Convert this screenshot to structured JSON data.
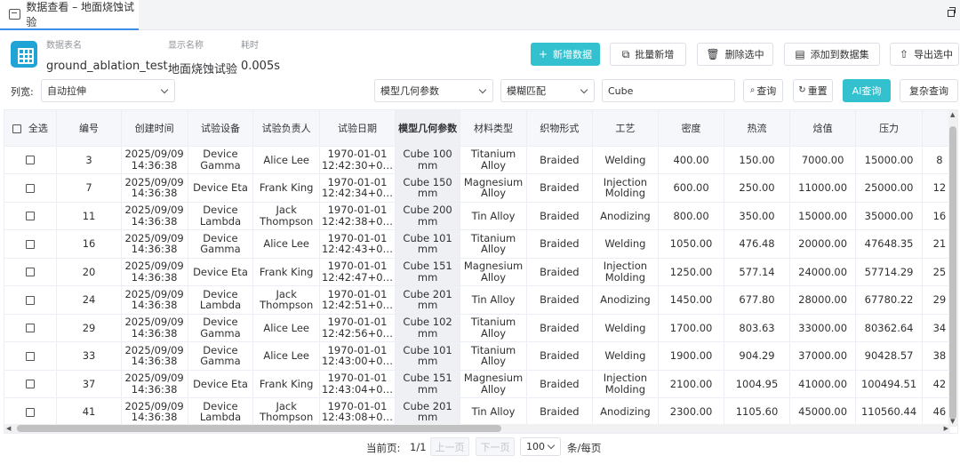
{
  "tab": {
    "title": "数据查看 – 地面烧蚀试验"
  },
  "info": {
    "table_name_label": "数据表名",
    "table_name": "ground_ablation_test",
    "display_name_label": "显示名称",
    "display_name": "地面烧蚀试验",
    "time_label": "耗时",
    "time": "0.005s"
  },
  "toolbar": {
    "add": "新增数据",
    "batch_add": "批量新增",
    "delete_selected": "删除选中",
    "add_to_dataset": "添加到数据集",
    "export_selected": "导出选中"
  },
  "filter": {
    "col_width_label": "列宽:",
    "col_width_value": "自动拉伸",
    "field_value": "模型几何参数",
    "match_value": "模糊匹配",
    "search_value": "Cube",
    "query": "查询",
    "reset": "重置",
    "ai_query": "AI查询",
    "complex_query": "复杂查询"
  },
  "table": {
    "select_all": "全选",
    "headers": [
      "编号",
      "创建时间",
      "试验设备",
      "试验负责人",
      "试验日期",
      "模型几何参数",
      "材料类型",
      "织物形式",
      "工艺",
      "密度",
      "热流",
      "焓值",
      "压力"
    ],
    "rows": [
      [
        "3",
        "2025/09/09 14:36:38",
        "Device Gamma",
        "Alice Lee",
        "1970-01-01 12:42:30+0…",
        "Cube 100 mm",
        "Titanium Alloy",
        "Braided",
        "Welding",
        "400.00",
        "150.00",
        "7000.00",
        "15000.00",
        "8"
      ],
      [
        "7",
        "2025/09/09 14:36:38",
        "Device Eta",
        "Frank King",
        "1970-01-01 12:42:34+0…",
        "Cube 150 mm",
        "Magnesium Alloy",
        "Braided",
        "Injection Molding",
        "600.00",
        "250.00",
        "11000.00",
        "25000.00",
        "12"
      ],
      [
        "11",
        "2025/09/09 14:36:38",
        "Device Lambda",
        "Jack Thompson",
        "1970-01-01 12:42:38+0…",
        "Cube 200 mm",
        "Tin Alloy",
        "Braided",
        "Anodizing",
        "800.00",
        "350.00",
        "15000.00",
        "35000.00",
        "16"
      ],
      [
        "16",
        "2025/09/09 14:36:38",
        "Device Gamma",
        "Alice Lee",
        "1970-01-01 12:42:43+0…",
        "Cube 101 mm",
        "Titanium Alloy",
        "Braided",
        "Welding",
        "1050.00",
        "476.48",
        "20000.00",
        "47648.35",
        "21"
      ],
      [
        "20",
        "2025/09/09 14:36:38",
        "Device Eta",
        "Frank King",
        "1970-01-01 12:42:47+0…",
        "Cube 151 mm",
        "Magnesium Alloy",
        "Braided",
        "Injection Molding",
        "1250.00",
        "577.14",
        "24000.00",
        "57714.29",
        "25"
      ],
      [
        "24",
        "2025/09/09 14:36:38",
        "Device Lambda",
        "Jack Thompson",
        "1970-01-01 12:42:51+0…",
        "Cube 201 mm",
        "Tin Alloy",
        "Braided",
        "Anodizing",
        "1450.00",
        "677.80",
        "28000.00",
        "67780.22",
        "29"
      ],
      [
        "29",
        "2025/09/09 14:36:38",
        "Device Gamma",
        "Alice Lee",
        "1970-01-01 12:42:56+0…",
        "Cube 102 mm",
        "Titanium Alloy",
        "Braided",
        "Welding",
        "1700.00",
        "803.63",
        "33000.00",
        "80362.64",
        "34"
      ],
      [
        "33",
        "2025/09/09 14:36:38",
        "Device Gamma",
        "Alice Lee",
        "1970-01-01 12:43:00+0…",
        "Cube 101 mm",
        "Titanium Alloy",
        "Braided",
        "Welding",
        "1900.00",
        "904.29",
        "37000.00",
        "90428.57",
        "38"
      ],
      [
        "37",
        "2025/09/09 14:36:38",
        "Device Eta",
        "Frank King",
        "1970-01-01 12:43:04+0…",
        "Cube 151 mm",
        "Magnesium Alloy",
        "Braided",
        "Injection Molding",
        "2100.00",
        "1004.95",
        "41000.00",
        "100494.51",
        "42"
      ],
      [
        "41",
        "2025/09/09 14:36:38",
        "Device Lambda",
        "Jack Thompson",
        "1970-01-01 12:43:08+0…",
        "Cube 201 mm",
        "Tin Alloy",
        "Braided",
        "Anodizing",
        "2300.00",
        "1105.60",
        "45000.00",
        "110560.44",
        "46"
      ]
    ]
  },
  "pager": {
    "current_label": "当前页:",
    "current": "1/1",
    "prev": "上一页",
    "next": "下一页",
    "page_size": "100",
    "per_page": "条/每页"
  },
  "colors": {
    "primary": "#33c1cf",
    "app_icon": "#20a4d6"
  }
}
